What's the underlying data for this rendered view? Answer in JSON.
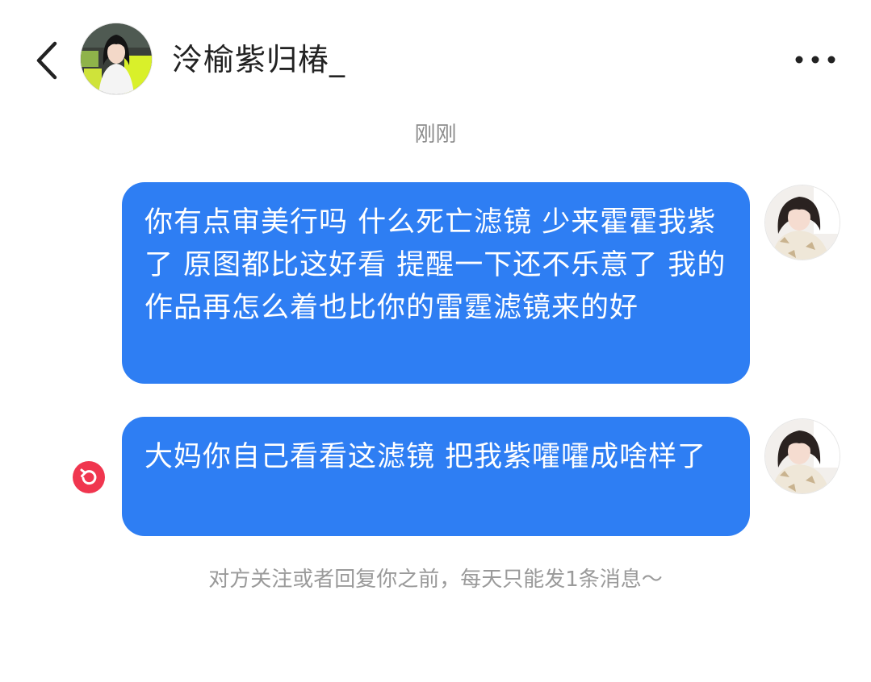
{
  "header": {
    "title": "泠榆紫归椿_",
    "back_icon": "chevron-left-icon",
    "more_icon": "more-horizontal-icon"
  },
  "conversation": {
    "timestamp": "刚刚",
    "messages": [
      {
        "sender": "self",
        "text": "你有点审美行吗 什么死亡滤镜 少来霍霍我紫了 原图都比这好看 提醒一下还不乐意了 我的作品再怎么着也比你的雷霆滤镜来的好"
      },
      {
        "sender": "self",
        "text": "大妈你自己看看这滤镜 把我紫嚯嚯成啥样了",
        "status_icon": "resend-icon"
      }
    ],
    "notice": "对方关注或者回复你之前，每天只能发1条消息～"
  },
  "colors": {
    "bubble": "#2e7ef3",
    "bubble_text": "#ffffff",
    "resend_badge": "#f0364f",
    "timestamp": "#8c8c8c",
    "notice": "#9a9a9a"
  }
}
